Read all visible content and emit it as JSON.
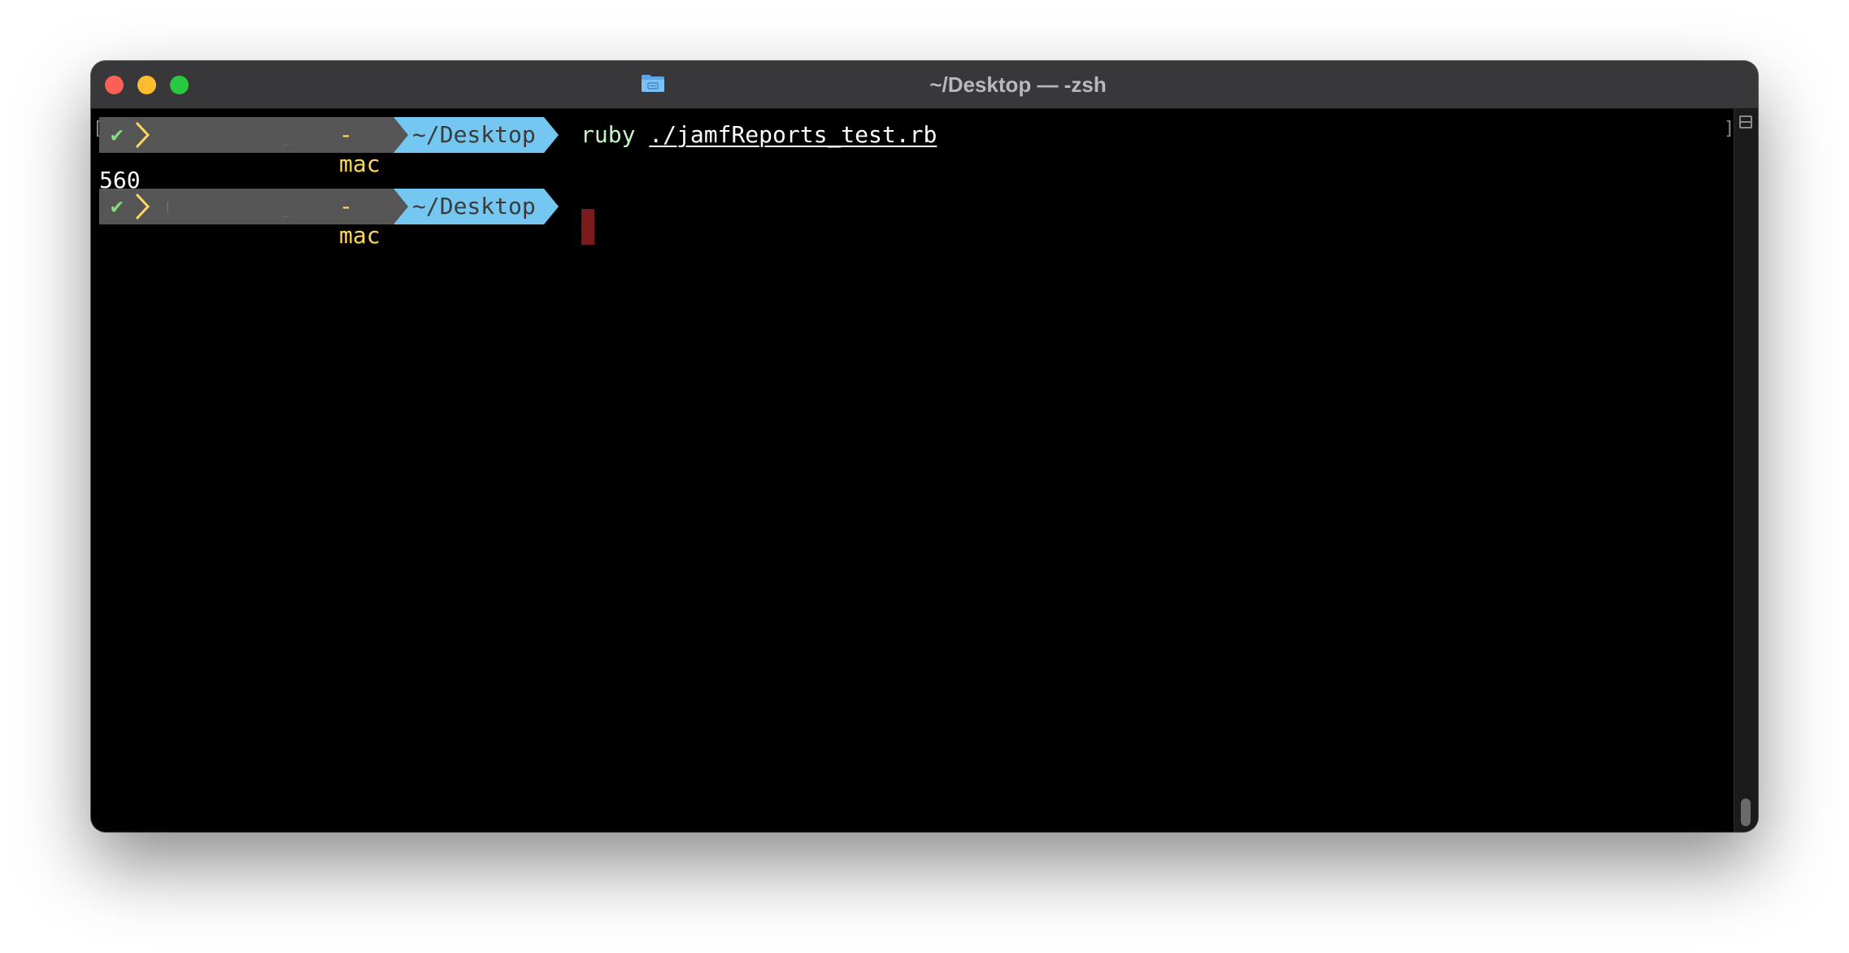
{
  "window": {
    "title": "~/Desktop — -zsh",
    "folder_icon": "folder-icon"
  },
  "terminal": {
    "bracket_left": "[",
    "bracket_right": "]",
    "prompts": [
      {
        "status": "✔",
        "user": "-mac",
        "directory": "~/Desktop",
        "command": "ruby",
        "argument": "./jamfReports_test.rb"
      },
      {
        "status": "✔",
        "user": "-mac",
        "directory": "~/Desktop",
        "command": "",
        "argument": ""
      }
    ],
    "output": "560"
  },
  "colors": {
    "titlebar": "#38383a",
    "background": "#000000",
    "user_segment": "#555555",
    "dir_segment": "#74c7f1",
    "user_text": "#ffd75f",
    "status_ok": "#7fe07f",
    "cursor": "#7a1a1a",
    "close": "#fe5f57",
    "minimize": "#febc2e",
    "maximize": "#28c840"
  }
}
